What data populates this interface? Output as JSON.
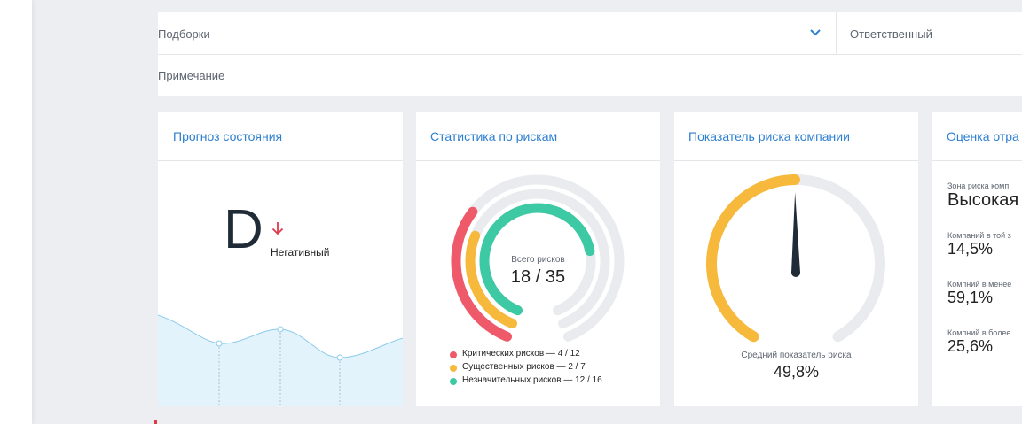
{
  "filters": {
    "collections_label": "Подборки",
    "responsible_label": "Ответственный",
    "note_label": "Примечание"
  },
  "forecast": {
    "title": "Прогноз состояния",
    "grade": "D",
    "trend_text": "Негативный"
  },
  "risk_stats": {
    "title": "Статистика по рискам",
    "center_label": "Всего рисков",
    "center_value": "18 / 35",
    "legend": [
      {
        "label": "Критических рисков — 4 / 12",
        "color": "#ef5a6a",
        "value": 4,
        "total": 12
      },
      {
        "label": "Существенных рисков — 2 / 7",
        "color": "#f6b93b",
        "value": 2,
        "total": 7
      },
      {
        "label": "Незначительных рисков — 12 / 16",
        "color": "#3cc9a4",
        "value": 12,
        "total": 16
      }
    ]
  },
  "company_risk": {
    "title": "Показатель риска компании",
    "label": "Средний показатель риска",
    "value": "49,8%",
    "value_num": 49.8
  },
  "assessment": {
    "title": "Оценка отра",
    "zone_label": "Зона риска комп",
    "zone_value": "Высокая",
    "rows": [
      {
        "label": "Компаний в той з",
        "value": "14,5%"
      },
      {
        "label": "Компний в менее",
        "value": "59,1%"
      },
      {
        "label": "Компний в более",
        "value": "25,6%"
      }
    ]
  },
  "colors": {
    "accent": "#2d7fd1",
    "critical": "#ef5a6a",
    "substantial": "#f6b93b",
    "minor": "#3cc9a4",
    "trend_down": "#e0394a",
    "needle": "#1f2b36"
  }
}
